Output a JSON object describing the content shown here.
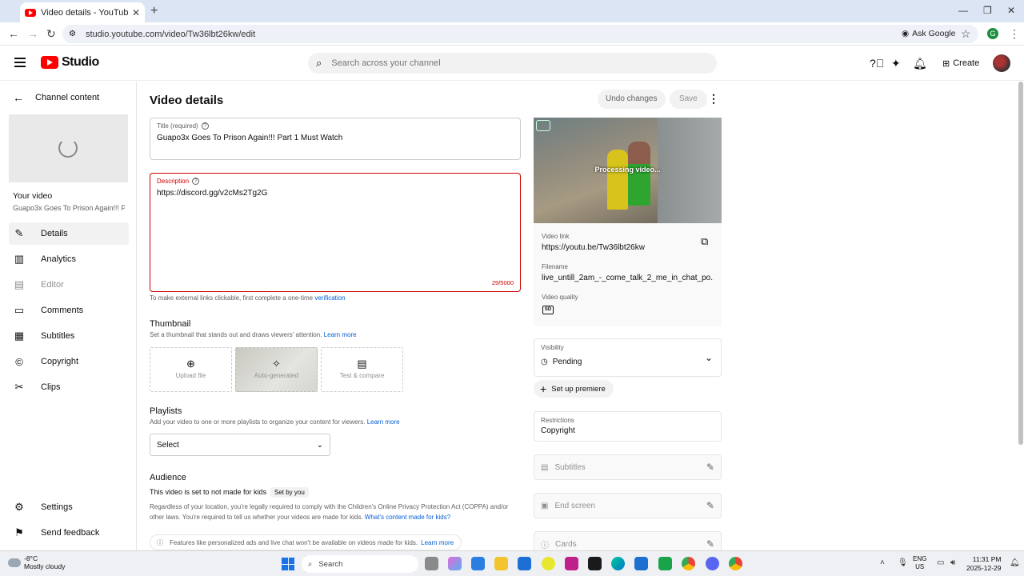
{
  "browser": {
    "tab_title": "Video details - YouTube Studio",
    "url": "studio.youtube.com/video/Tw36lbt26kw/edit",
    "ask_google": "Ask Google",
    "profile_initial": "G"
  },
  "header": {
    "logo_text": "Studio",
    "search_placeholder": "Search across your channel",
    "create_label": "Create"
  },
  "sidebar": {
    "back_label": "Channel content",
    "your_video_label": "Your video",
    "your_video_title": "Guapo3x Goes To Prison Again!!! Pa...",
    "items": [
      {
        "label": "Details",
        "icon": "pencil-icon"
      },
      {
        "label": "Analytics",
        "icon": "analytics-icon"
      },
      {
        "label": "Editor",
        "icon": "editor-icon"
      },
      {
        "label": "Comments",
        "icon": "comments-icon"
      },
      {
        "label": "Subtitles",
        "icon": "subtitles-icon"
      },
      {
        "label": "Copyright",
        "icon": "copyright-icon"
      },
      {
        "label": "Clips",
        "icon": "scissors-icon"
      }
    ],
    "settings_label": "Settings",
    "feedback_label": "Send feedback"
  },
  "main": {
    "page_title": "Video details",
    "undo_label": "Undo changes",
    "save_label": "Save",
    "title_field": {
      "label": "Title (required)",
      "value": "Guapo3x Goes To Prison Again!!! Part 1 Must Watch"
    },
    "description_field": {
      "label": "Description",
      "value": "https://discord.gg/v2cMs2Tg2G",
      "count": "29/5000"
    },
    "link_helper_text": "To make external links clickable, first complete a one-time",
    "link_helper_link": "verification",
    "thumbnail": {
      "heading": "Thumbnail",
      "helper": "Set a thumbnail that stands out and draws viewers' attention.",
      "learn_more": "Learn more",
      "options": [
        "Upload file",
        "Auto-generated",
        "Test & compare"
      ]
    },
    "playlists": {
      "heading": "Playlists",
      "helper": "Add your video to one or more playlists to organize your content for viewers.",
      "learn_more": "Learn more",
      "select_value": "Select"
    },
    "audience": {
      "heading": "Audience",
      "status": "This video is set to not made for kids",
      "chip": "Set by you",
      "body": "Regardless of your location, you're legally required to comply with the Children's Online Privacy Protection Act (COPPA) and/or other laws. You're required to tell us whether your videos are made for kids.",
      "body_link": "What's content made for kids?",
      "info": "Features like personalized ads and live chat won't be available on videos made for kids.",
      "info_link": "Learn more"
    }
  },
  "video_panel": {
    "processing": "Processing video...",
    "link_label": "Video link",
    "link_value": "https://youtu.be/Tw36lbt26kw",
    "filename_label": "Filename",
    "filename_value": "live_untill_2am_-_come_talk_2_me_in_chat_po...",
    "quality_label": "Video quality",
    "quality_badge": "SD",
    "visibility_label": "Visibility",
    "visibility_value": "Pending",
    "premiere_label": "Set up premiere",
    "restrictions_label": "Restrictions",
    "restrictions_value": "Copyright",
    "features": [
      "Subtitles",
      "End screen",
      "Cards"
    ]
  },
  "taskbar": {
    "temp": "-8°C",
    "weather": "Mostly cloudy",
    "search": "Search",
    "lang_top": "ENG",
    "lang_bottom": "US",
    "time": "11:31 PM",
    "date": "2025-12-29"
  },
  "colors": {
    "accent": "#065fd4",
    "error": "#cc0000",
    "brand": "#ff0000"
  }
}
